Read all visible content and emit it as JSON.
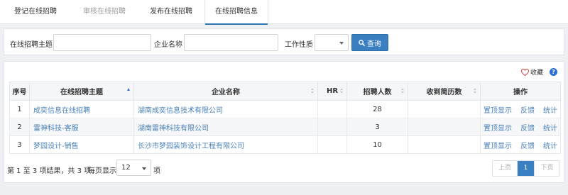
{
  "tabs": [
    {
      "label": "登记在线招聘"
    },
    {
      "label": "审核在线招聘"
    },
    {
      "label": "发布在线招聘"
    },
    {
      "label": "在线招聘信息"
    }
  ],
  "search": {
    "topic_label": "在线招聘主题",
    "topic_value": "",
    "company_label": "企业名称",
    "company_value": "",
    "nature_label": "工作性质",
    "nature_value": "",
    "query_label": "查询"
  },
  "toolbar": {
    "favorite_label": "收藏",
    "help_label": "?"
  },
  "table": {
    "headers": [
      "序号",
      "在线招聘主题",
      "企业名称",
      "HR",
      "招聘人数",
      "收到简历数",
      "操作"
    ],
    "rows": [
      {
        "index": "1",
        "topic": "成奕信息在线招聘",
        "company": "湖南成奕信息技术有限公司",
        "hr": "",
        "count": "28",
        "resumes": "",
        "ops": [
          "置顶显示",
          "反馈",
          "统计"
        ]
      },
      {
        "index": "2",
        "topic": "雷神科技-客服",
        "company": "湖南雷神科技有限公司",
        "hr": "",
        "count": "3",
        "resumes": "",
        "ops": [
          "置顶显示",
          "反馈",
          "统计"
        ]
      },
      {
        "index": "3",
        "topic": "梦园设计-销售",
        "company": "长沙市梦园装饰设计工程有限公司",
        "hr": "",
        "count": "10",
        "resumes": "",
        "ops": [
          "置顶显示",
          "反馈",
          "统计"
        ]
      }
    ]
  },
  "footer": {
    "info": "第 1 至 3 项结果，共 3 项",
    "per_page_label": "每页显示",
    "per_page_value": "12",
    "per_page_unit": "项"
  },
  "pager": {
    "prev": "上页",
    "current": "1",
    "next": "下页"
  },
  "colors": {
    "accent": "#3a7fc1",
    "link": "#4a82b9",
    "heart": "#d9534f"
  }
}
